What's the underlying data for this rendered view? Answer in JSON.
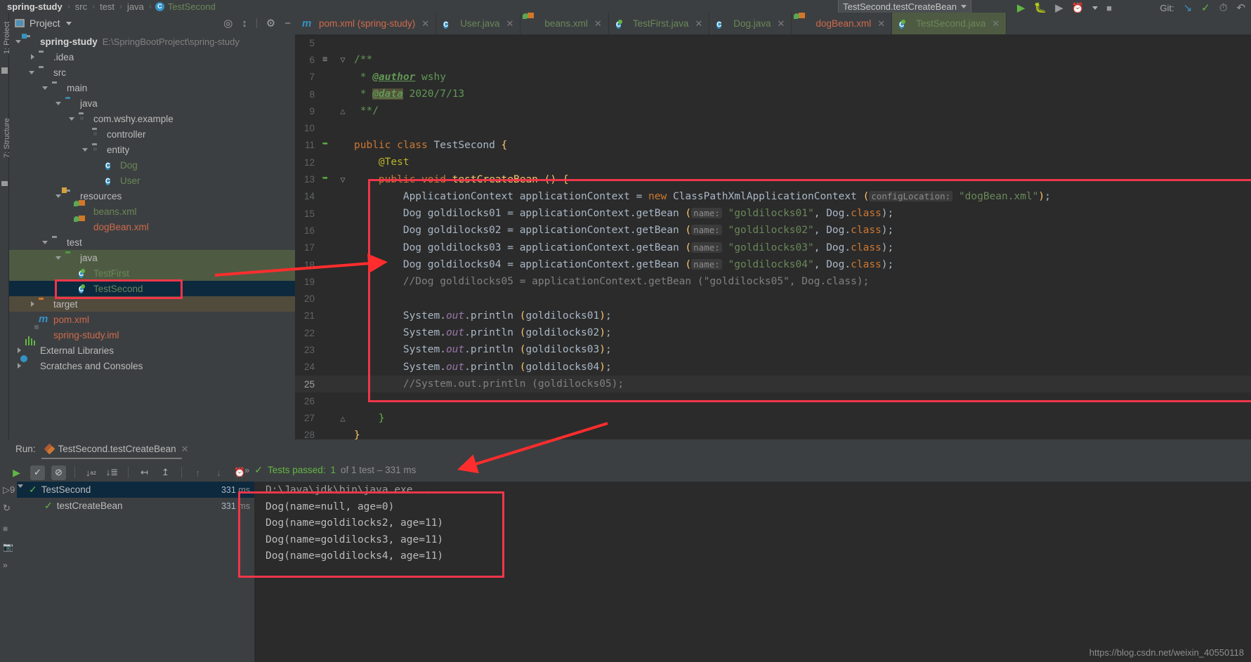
{
  "breadcrumb": {
    "items": [
      "spring-study",
      "src",
      "test",
      "java",
      "TestSecond"
    ],
    "separator": "›"
  },
  "toolbar": {
    "run_config": "TestSecond.testCreateBean",
    "git_label": "Git:",
    "icons": [
      "run-icon",
      "debug-icon",
      "run-coverage-icon",
      "profile-icon",
      "stop-icon",
      "git-update-icon",
      "git-commit-icon",
      "git-history-icon",
      "git-rollback-icon"
    ]
  },
  "project_panel": {
    "title": "Project",
    "vertical_tabs": [
      "1: Project",
      "7: Structure"
    ],
    "header_icons": [
      "locate-icon",
      "collapse-all-icon",
      "gear-icon",
      "hide-icon"
    ],
    "tree": [
      {
        "depth": 0,
        "twisty": "down",
        "icon": "module-folder-icon",
        "label": "spring-study",
        "style": "bold",
        "sub": "E:\\SpringBootProject\\spring-study"
      },
      {
        "depth": 1,
        "twisty": "right",
        "icon": "folder-icon",
        "label": ".idea"
      },
      {
        "depth": 1,
        "twisty": "down",
        "icon": "folder-icon",
        "label": "src"
      },
      {
        "depth": 2,
        "twisty": "down",
        "icon": "folder-icon",
        "label": "main"
      },
      {
        "depth": 3,
        "twisty": "down",
        "icon": "source-folder-icon",
        "label": "java"
      },
      {
        "depth": 4,
        "twisty": "down",
        "icon": "package-icon",
        "label": "com.wshy.example"
      },
      {
        "depth": 5,
        "twisty": "none",
        "icon": "package-icon",
        "label": "controller"
      },
      {
        "depth": 5,
        "twisty": "down",
        "icon": "package-icon",
        "label": "entity"
      },
      {
        "depth": 6,
        "twisty": "none",
        "icon": "class-icon",
        "label": "Dog",
        "style": "green"
      },
      {
        "depth": 6,
        "twisty": "none",
        "icon": "class-icon",
        "label": "User",
        "style": "green"
      },
      {
        "depth": 3,
        "twisty": "down",
        "icon": "resource-folder-icon",
        "label": "resources"
      },
      {
        "depth": 4,
        "twisty": "none",
        "icon": "spring-xml-icon",
        "label": "beans.xml",
        "style": "green"
      },
      {
        "depth": 4,
        "twisty": "none",
        "icon": "spring-xml-icon",
        "label": "dogBean.xml",
        "style": "red"
      },
      {
        "depth": 2,
        "twisty": "down",
        "icon": "folder-icon",
        "label": "test"
      },
      {
        "depth": 3,
        "twisty": "down",
        "icon": "test-source-folder-icon",
        "label": "java",
        "row": "sel-green"
      },
      {
        "depth": 4,
        "twisty": "none",
        "icon": "test-class-icon",
        "label": "TestFirst",
        "style": "green",
        "row": "sel-green"
      },
      {
        "depth": 4,
        "twisty": "none",
        "icon": "test-class-icon",
        "label": "TestSecond",
        "style": "green",
        "row": "sel-blue"
      },
      {
        "depth": 1,
        "twisty": "right",
        "icon": "excluded-folder-icon",
        "label": "target",
        "row": "sel-brown"
      },
      {
        "depth": 1,
        "twisty": "none",
        "icon": "maven-icon",
        "label": "pom.xml",
        "style": "red"
      },
      {
        "depth": 1,
        "twisty": "none",
        "icon": "iml-icon",
        "label": "spring-study.iml",
        "style": "red"
      },
      {
        "depth": 0,
        "twisty": "right",
        "icon": "library-icon",
        "label": "External Libraries"
      },
      {
        "depth": 0,
        "twisty": "right",
        "icon": "scratches-icon",
        "label": "Scratches and Consoles"
      }
    ]
  },
  "editor": {
    "tabs": [
      {
        "label": "pom.xml (spring-study)",
        "icon": "maven-icon",
        "color": "red",
        "active": false
      },
      {
        "label": "User.java",
        "icon": "class-icon",
        "color": "green",
        "active": false
      },
      {
        "label": "beans.xml",
        "icon": "spring-xml-icon",
        "color": "green",
        "active": false
      },
      {
        "label": "TestFirst.java",
        "icon": "test-class-icon",
        "color": "green",
        "active": false
      },
      {
        "label": "Dog.java",
        "icon": "class-icon",
        "color": "green",
        "active": false
      },
      {
        "label": "dogBean.xml",
        "icon": "spring-xml-icon",
        "color": "red",
        "active": false
      },
      {
        "label": "TestSecond.java",
        "icon": "test-class-icon",
        "color": "green",
        "active": true
      }
    ],
    "close_glyph": "✕",
    "lines": [
      {
        "n": "5",
        "gutter": "",
        "fold": "",
        "segs": []
      },
      {
        "n": "6",
        "gutter": "javadoc-icon",
        "fold": "fold-open",
        "segs": [
          {
            "t": "/**",
            "c": "doc"
          }
        ]
      },
      {
        "n": "7",
        "gutter": "",
        "fold": "",
        "segs": [
          {
            "t": " * ",
            "c": "doc"
          },
          {
            "t": "@author",
            "c": "docu"
          },
          {
            "t": " wshy",
            "c": "doc"
          }
        ]
      },
      {
        "n": "8",
        "gutter": "",
        "fold": "",
        "segs": [
          {
            "t": " * ",
            "c": "doc"
          },
          {
            "t": "@data",
            "c": "docu hl"
          },
          {
            "t": " 2020/7/13",
            "c": "doc"
          }
        ]
      },
      {
        "n": "9",
        "gutter": "",
        "fold": "fold-end",
        "segs": [
          {
            "t": " **/",
            "c": "doc"
          }
        ]
      },
      {
        "n": "10",
        "gutter": "",
        "fold": "",
        "segs": []
      },
      {
        "n": "11",
        "gutter": "run-class-icon",
        "fold": "",
        "segs": [
          {
            "t": "public class ",
            "c": "kw"
          },
          {
            "t": "TestSecond ",
            "c": "typ"
          },
          {
            "t": "{",
            "c": "braceY"
          }
        ]
      },
      {
        "n": "12",
        "gutter": "",
        "fold": "",
        "segs": [
          {
            "t": "    ",
            "c": ""
          },
          {
            "t": "@Test",
            "c": "anno"
          }
        ]
      },
      {
        "n": "13",
        "gutter": "run-method-icon",
        "fold": "fold-open",
        "segs": [
          {
            "t": "    ",
            "c": ""
          },
          {
            "t": "public void ",
            "c": "kw"
          },
          {
            "t": "testCreateBean ",
            "c": "fn"
          },
          {
            "t": "()",
            "c": "braceY"
          },
          {
            "t": " {",
            "c": "braceY"
          }
        ]
      },
      {
        "n": "14",
        "gutter": "",
        "fold": "",
        "segs": [
          {
            "t": "        ApplicationContext applicationContext = ",
            "c": "typ"
          },
          {
            "t": "new ",
            "c": "kw"
          },
          {
            "t": "ClassPathXmlApplicationContext ",
            "c": "typ"
          },
          {
            "t": "(",
            "c": "braceY"
          },
          {
            "t": "configLocation:",
            "c": "hint"
          },
          {
            "t": " \"dogBean.xml\"",
            "c": "str"
          },
          {
            "t": ")",
            "c": "braceY"
          },
          {
            "t": ";",
            "c": "typ"
          }
        ]
      },
      {
        "n": "15",
        "gutter": "",
        "fold": "",
        "segs": [
          {
            "t": "        Dog goldilocks01 = applicationContext.getBean ",
            "c": "typ"
          },
          {
            "t": "(",
            "c": "braceY"
          },
          {
            "t": "name:",
            "c": "hint"
          },
          {
            "t": " \"goldilocks01\"",
            "c": "str"
          },
          {
            "t": ", Dog.",
            "c": "typ"
          },
          {
            "t": "class",
            "c": "kw"
          },
          {
            "t": ");",
            "c": "typ"
          }
        ]
      },
      {
        "n": "16",
        "gutter": "",
        "fold": "",
        "segs": [
          {
            "t": "        Dog goldilocks02 = applicationContext.getBean ",
            "c": "typ"
          },
          {
            "t": "(",
            "c": "braceY"
          },
          {
            "t": "name:",
            "c": "hint"
          },
          {
            "t": " \"goldilocks02\"",
            "c": "str"
          },
          {
            "t": ", Dog.",
            "c": "typ"
          },
          {
            "t": "class",
            "c": "kw"
          },
          {
            "t": ");",
            "c": "typ"
          }
        ]
      },
      {
        "n": "17",
        "gutter": "",
        "fold": "",
        "segs": [
          {
            "t": "        Dog goldilocks03 = applicationContext.getBean ",
            "c": "typ"
          },
          {
            "t": "(",
            "c": "braceY"
          },
          {
            "t": "name:",
            "c": "hint"
          },
          {
            "t": " \"goldilocks03\"",
            "c": "str"
          },
          {
            "t": ", Dog.",
            "c": "typ"
          },
          {
            "t": "class",
            "c": "kw"
          },
          {
            "t": ");",
            "c": "typ"
          }
        ]
      },
      {
        "n": "18",
        "gutter": "",
        "fold": "",
        "segs": [
          {
            "t": "        Dog goldilocks04 = applicationContext.getBean ",
            "c": "typ"
          },
          {
            "t": "(",
            "c": "braceY"
          },
          {
            "t": "name:",
            "c": "hint"
          },
          {
            "t": " \"goldilocks04\"",
            "c": "str"
          },
          {
            "t": ", Dog.",
            "c": "typ"
          },
          {
            "t": "class",
            "c": "kw"
          },
          {
            "t": ");",
            "c": "typ"
          }
        ]
      },
      {
        "n": "19",
        "gutter": "",
        "fold": "",
        "segs": [
          {
            "t": "        //Dog goldilocks05 = applicationContext.getBean (\"goldilocks05\", Dog.class);",
            "c": "cmt"
          }
        ]
      },
      {
        "n": "20",
        "gutter": "",
        "fold": "",
        "segs": []
      },
      {
        "n": "21",
        "gutter": "",
        "fold": "",
        "segs": [
          {
            "t": "        System.",
            "c": "typ"
          },
          {
            "t": "out",
            "c": "fld"
          },
          {
            "t": ".println ",
            "c": "typ"
          },
          {
            "t": "(",
            "c": "braceY"
          },
          {
            "t": "goldilocks01",
            "c": "typ"
          },
          {
            "t": ")",
            "c": "braceY"
          },
          {
            "t": ";",
            "c": "typ"
          }
        ]
      },
      {
        "n": "22",
        "gutter": "",
        "fold": "",
        "segs": [
          {
            "t": "        System.",
            "c": "typ"
          },
          {
            "t": "out",
            "c": "fld"
          },
          {
            "t": ".println ",
            "c": "typ"
          },
          {
            "t": "(",
            "c": "braceY"
          },
          {
            "t": "goldilocks02",
            "c": "typ"
          },
          {
            "t": ")",
            "c": "braceY"
          },
          {
            "t": ";",
            "c": "typ"
          }
        ]
      },
      {
        "n": "23",
        "gutter": "",
        "fold": "",
        "segs": [
          {
            "t": "        System.",
            "c": "typ"
          },
          {
            "t": "out",
            "c": "fld"
          },
          {
            "t": ".println ",
            "c": "typ"
          },
          {
            "t": "(",
            "c": "braceY"
          },
          {
            "t": "goldilocks03",
            "c": "typ"
          },
          {
            "t": ")",
            "c": "braceY"
          },
          {
            "t": ";",
            "c": "typ"
          }
        ]
      },
      {
        "n": "24",
        "gutter": "",
        "fold": "",
        "segs": [
          {
            "t": "        System.",
            "c": "typ"
          },
          {
            "t": "out",
            "c": "fld"
          },
          {
            "t": ".println ",
            "c": "typ"
          },
          {
            "t": "(",
            "c": "braceY"
          },
          {
            "t": "goldilocks04",
            "c": "typ"
          },
          {
            "t": ")",
            "c": "braceY"
          },
          {
            "t": ";",
            "c": "typ"
          }
        ]
      },
      {
        "n": "25",
        "gutter": "",
        "fold": "",
        "segs": [
          {
            "t": "        //System.out.println (goldilocks05);",
            "c": "cmt"
          }
        ],
        "current": true
      },
      {
        "n": "26",
        "gutter": "",
        "fold": "",
        "segs": []
      },
      {
        "n": "27",
        "gutter": "",
        "fold": "fold-end",
        "segs": [
          {
            "t": "    }",
            "c": "braceG"
          }
        ]
      },
      {
        "n": "28",
        "gutter": "",
        "fold": "",
        "segs": [
          {
            "t": "}",
            "c": "braceY"
          }
        ]
      }
    ]
  },
  "run_panel": {
    "run_label": "Run:",
    "tab_label": "TestSecond.testCreateBean",
    "close_glyph": "✕",
    "toolbar_icons": [
      "rerun-icon",
      "show-passed-icon",
      "hide-ignored-icon",
      "sort-alphabetically-icon",
      "sort-by-duration-icon",
      "expand-all-icon",
      "collapse-all-icon",
      "prev-failed-icon",
      "next-failed-icon",
      "test-history-icon",
      "expand-output-icon"
    ],
    "status": {
      "prefix": "Tests passed:",
      "count": "1",
      "of": "of 1 test – 331 ms"
    },
    "tests": [
      {
        "depth": 0,
        "twisty": "down",
        "label": "TestSecond",
        "time": "331",
        "unit": "ms",
        "selected": true
      },
      {
        "depth": 1,
        "twisty": "none",
        "label": "testCreateBean",
        "time": "331",
        "unit": "ms",
        "selected": false
      }
    ],
    "console": [
      {
        "text": "D:\\Java\\jdk\\bin\\java.exe ...",
        "dim": true
      },
      {
        "text": "Dog(name=null, age=0)",
        "dim": false
      },
      {
        "text": "Dog(name=goldilocks2, age=11)",
        "dim": false
      },
      {
        "text": "Dog(name=goldilocks3, age=11)",
        "dim": false
      },
      {
        "text": "Dog(name=goldilocks4, age=11)",
        "dim": false
      }
    ],
    "side_icons": [
      "rerun-side-icon",
      "restart-side-icon",
      "stop-side-icon",
      "dump-side-icon",
      "more-side-icon"
    ]
  },
  "watermark": "https://blog.csdn.net/weixin_40550118",
  "colors": {
    "accent_blue": "#3592c4",
    "green": "#62b543",
    "annotation_red": "#f0364a",
    "selection_blue": "#0d293e",
    "selection_green": "#4e5b42",
    "editor_bg": "#2b2b2b",
    "panel_bg": "#3c3f41"
  }
}
